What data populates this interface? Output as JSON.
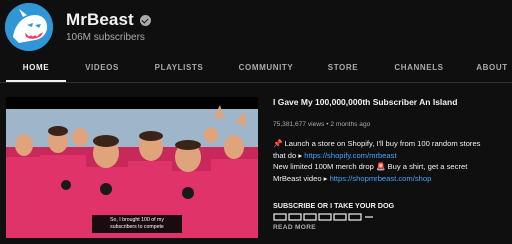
{
  "channel": {
    "name": "MrBeast",
    "subscribers": "106M subscribers"
  },
  "tabs": [
    {
      "label": "HOME",
      "active": true
    },
    {
      "label": "VIDEOS",
      "active": false
    },
    {
      "label": "PLAYLISTS",
      "active": false
    },
    {
      "label": "COMMUNITY",
      "active": false
    },
    {
      "label": "STORE",
      "active": false
    },
    {
      "label": "CHANNELS",
      "active": false
    },
    {
      "label": "ABOUT",
      "active": false
    }
  ],
  "featured_video": {
    "caption_line1": "So, I brought 100 of my",
    "caption_line2": "subscribers to compete",
    "title": "I Gave My 100,000,000th Subscriber An Island",
    "views": "75,381,677 views",
    "separator": "•",
    "age": "2 months ago",
    "desc_line1": "📌 Launch a store on Shopify, I'll buy from 100 random stores",
    "desc_line2_text": "that do ▸ ",
    "desc_line2_link": "https://shopify.com/mrbeast",
    "desc_line3": "New limited 100M merch drop 🚨 Buy a shirt, get a secret",
    "desc_line4_text": "MrBeast video ▸ ",
    "desc_line4_link": "https://shopmrbeast.com/shop",
    "subscribe_line": "SUBSCRIBE OR I TAKE YOUR DOG",
    "read_more": "READ MORE"
  },
  "colors": {
    "background": "#0f0f0f",
    "text": "#f1f1f1",
    "muted": "#aaaaaa",
    "link": "#3ea6ff",
    "avatar_blue": "#2f97d6",
    "shirt_pink": "#e0336a"
  },
  "icons": {
    "verified": "verified-check-icon",
    "avatar": "mrbeast-panther-logo"
  }
}
